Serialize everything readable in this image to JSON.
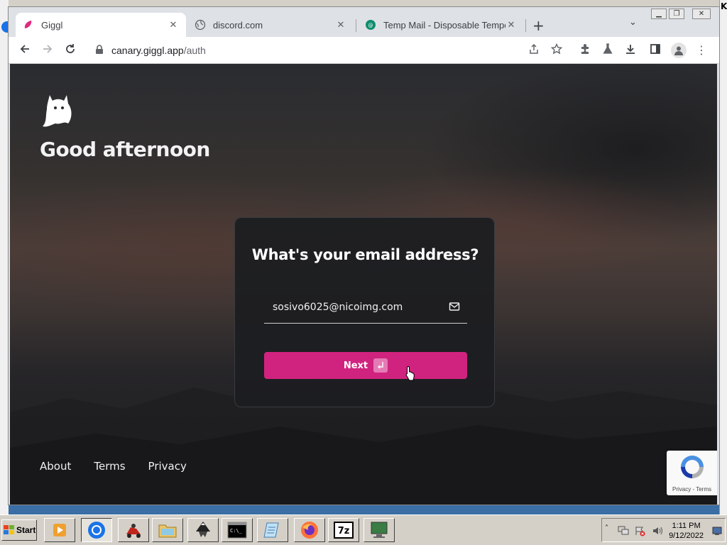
{
  "browser": {
    "tabs": [
      {
        "title": "Giggl",
        "active": true
      },
      {
        "title": "discord.com",
        "active": false
      },
      {
        "title": "Temp Mail - Disposable Temporary",
        "active": false
      }
    ],
    "url_host": "canary.giggl.app",
    "url_path": "/auth"
  },
  "page": {
    "greeting": "Good afternoon",
    "card_title": "What's your email address?",
    "email_value": "sosivo6025@nicoimg.com",
    "next_label": "Next",
    "footer_links": [
      "About",
      "Terms",
      "Privacy"
    ],
    "recaptcha_terms": "Privacy - Terms"
  },
  "taskbar": {
    "start_label": "Start",
    "clock_time": "1:11 PM",
    "clock_date": "9/12/2022"
  },
  "colors": {
    "accent": "#d0237f",
    "card_bg": "#1c1d21"
  }
}
